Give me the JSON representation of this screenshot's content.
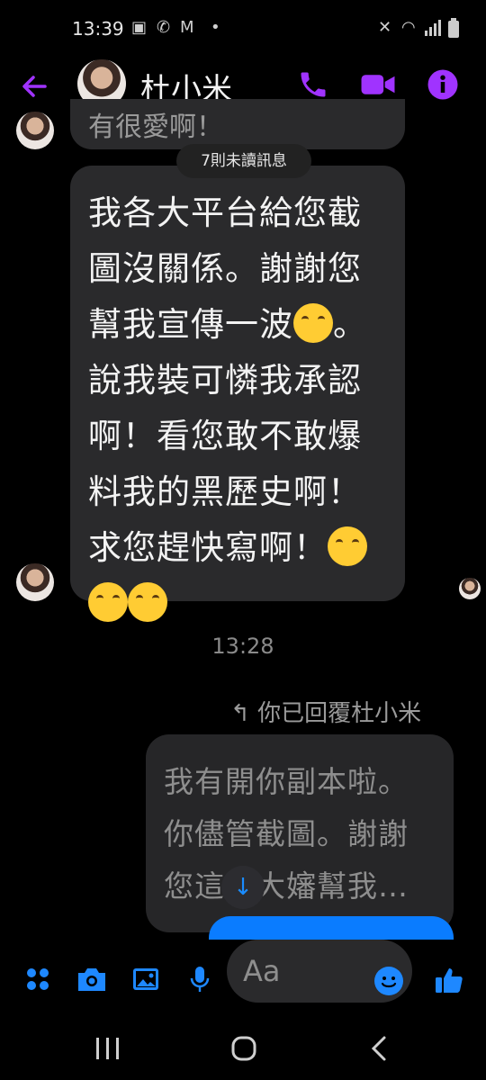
{
  "status_bar": {
    "time": "13:39"
  },
  "header": {
    "contact_name": "杜小米"
  },
  "icons": {
    "back": "arrow-left-icon",
    "call": "phone-icon",
    "video": "video-camera-icon",
    "info": "info-icon",
    "apps": "four-dots-icon",
    "camera": "camera-icon",
    "gallery": "image-icon",
    "mic": "microphone-icon",
    "emoji": "smiley-icon",
    "like": "thumbs-up-icon"
  },
  "messages": {
    "top_partial": "有很愛啊！",
    "unread_pill": "7則未讀訊息",
    "incoming_text": "我各大平台給您截\n圖沒關係。謝謝您\n幫我宣傳一波",
    "incoming_text_cont": "。\n說我裝可憐我承認\n啊！看您敢不敢爆\n料我的黑歷史啊！\n求您趕快寫啊！",
    "timestamp": "13:28",
    "reply_label": "你已回覆杜小米",
    "outgoing_text": "我有開你副本啦。\n你儘管截圖。謝謝\n您這個大嬸幫我…"
  },
  "composer": {
    "placeholder": "Aa"
  },
  "colors": {
    "accent_purple": "#a033ff",
    "accent_blue": "#1e88ff",
    "bubble_incoming": "#2a2a2c",
    "background": "#000000"
  }
}
